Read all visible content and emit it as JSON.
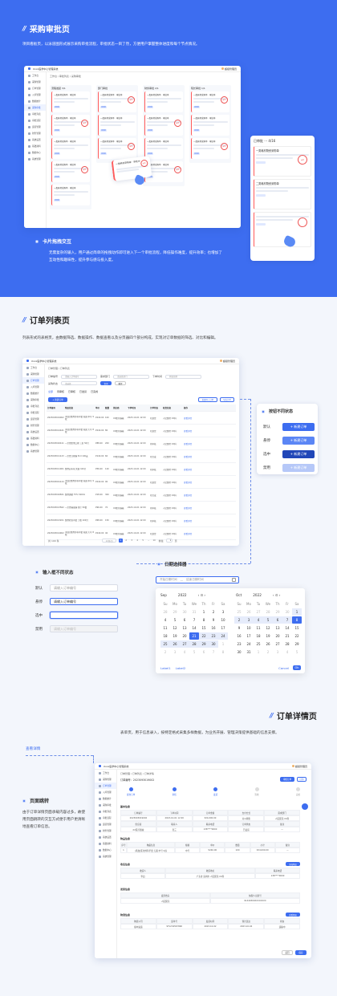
{
  "section1": {
    "title": "采购审批页",
    "desc": "项目看板页，以泳道图形式展示采购审批流程，审批状态一目了然，方便用户掌握整体进度和每个节点情况。",
    "bullet_title": "卡片拖拽交互",
    "bullet_desc": "无需复杂的输入，用户通过简单的拖拽动作即可进入下一个审批流程，降低操作难度，提升效率；也增加了互动性和趣味性，提升参与感与投入度。",
    "app": {
      "logo": "Xxxx医学中心管理系统",
      "breadcrumb": "工作台 / 审批列表 / 采购审批",
      "user": "超级管理员",
      "side_items": [
        "工作台",
        "采购管理",
        "订单管理",
        "入库管理",
        "数据统计",
        "采购审批",
        "审批列表",
        "审批流程",
        "运营管理",
        "财务管理",
        "系统设置",
        "基础资料",
        "数据中心",
        "系统管理"
      ],
      "columns": [
        "流程发起 3/1",
        "部门审批",
        "财务审批 2/1",
        "院长审批 1/1"
      ],
      "card_title": "一类耗材采购单 · 审批中",
      "card_tag": "待审批",
      "stamp": "审批"
    },
    "popup": {
      "title": "已审批 ··· 4/16",
      "card1": "一类耗材物资采购单",
      "card2": "二类耗材物资采购单",
      "stamp": "审批"
    }
  },
  "section2": {
    "title": "订单列表页",
    "desc": "列表形式的表格页，由数据筛选、数据操作、数据查看以及分页器四个部分构成，实现对订单数据的筛选、对比和编辑。",
    "app": {
      "logo": "Xxxx医学中心管理系统",
      "breadcrumb": "订单管理 / 订单列表",
      "user": "超级管理员",
      "filters": {
        "order_no": "订单编号",
        "order_ph": "请输入订单编号",
        "dept": "需求部门",
        "dept_ph": "请选择部门",
        "time": "下单时间",
        "start": "开始日期",
        "end": "结束日期",
        "status": "采购状态",
        "status_ph": "请选择",
        "search": "查询",
        "reset": "重置"
      },
      "tabs": [
        "全部",
        "待审核",
        "已审核",
        "已发货",
        "已完成"
      ],
      "new_btn": "+ 新建订单",
      "bulk": [
        "批量导入订单",
        "导出订单"
      ],
      "columns": [
        "订单编号",
        "物品信息",
        "单价",
        "数量",
        "供应商",
        "下单时间",
        "订单状态",
        "收货信息",
        "操作"
      ],
      "rows": [
        [
          "2023093019002",
          "(乳胶)医用外科手套 无菌 中号 9双",
          "¥240.00",
          "100",
          "XX医疗器械",
          "2023-10-01 12:00",
          "已发货",
          "人民医院 XX科",
          "查看详情"
        ],
        [
          "2023093014441",
          "(乳胶)医用外科手套 无菌 大号 8双",
          "¥240.00",
          "80",
          "XX医疗器械",
          "2023-10-01 12:00",
          "已发货",
          "人民医院 XX科",
          "查看详情"
        ],
        [
          "2023093016411",
          "一次性医用口罩 三层 50只",
          "¥88.00",
          "200",
          "XX医疗器械",
          "2023-10-01 12:00",
          "待审核",
          "人民医院 XX科",
          "查看详情"
        ],
        [
          "2023093011123",
          "一次性注射器 5ml 100支",
          "¥140.00",
          "60",
          "XX医疗器械",
          "2023-10-01 12:00",
          "已完成",
          "人民医院 XX科",
          "查看详情"
        ],
        [
          "2023093011001",
          "医用纱布块 灭菌 100片",
          "¥56.00",
          "120",
          "XX医疗器械",
          "2023-10-01 12:00",
          "已审核",
          "人民医院 XX科",
          "查看详情"
        ],
        [
          "2023093001124",
          "(乳胶)医用外科手套 无菌 中号 9双",
          "¥240.00",
          "90",
          "XX医疗器械",
          "2023-10-01 12:00",
          "已发货",
          "人民医院 XX科",
          "查看详情"
        ],
        [
          "2023093016821",
          "医用酒精 75% 500ml",
          "¥18.00",
          "300",
          "XX医疗器械",
          "2023-10-01 12:00",
          "已完成",
          "人民医院 XX科",
          "查看详情"
        ],
        [
          "2023093013562",
          "一次性输液器 带针 50套",
          "¥96.00",
          "70",
          "XX医疗器械",
          "2023-10-01 12:00",
          "待审核",
          "人民医院 XX科",
          "查看详情"
        ],
        [
          "2023093013201",
          "医用检查手套 丁腈 100只",
          "¥68.00",
          "150",
          "XX医疗器械",
          "2023-10-01 12:00",
          "已审核",
          "人民医院 XX科",
          "查看详情"
        ],
        [
          "2023093014902",
          "(乳胶)医用外科手套 无菌 大号 8双",
          "¥240.00",
          "40",
          "XX医疗器械",
          "2023-10-01 12:00",
          "已发货",
          "人民医院 XX科",
          "查看详情"
        ]
      ],
      "pager": {
        "total": "共 100 条",
        "size": "10条/页",
        "pages": [
          "1",
          "2",
          "3",
          "4",
          "5",
          "...",
          "10"
        ],
        "goto": "前往",
        "page": "1",
        "unit": "页"
      }
    },
    "button_states": {
      "title": "按钮不同状态",
      "labels": [
        "默认",
        "悬停",
        "选中",
        "禁用"
      ],
      "btn": "+ 新建订单"
    },
    "input_states": {
      "title": "输入框不同状态",
      "labels": [
        "默认",
        "悬停",
        "选中",
        "禁用"
      ],
      "values": [
        "请输入订单编号",
        "请输入订单编号",
        "",
        "请输入订单编号"
      ]
    },
    "date_picker": {
      "title": "日期选择器",
      "start_ph": "开始日期时间",
      "sep": "—",
      "end_ph": "结束日期时间",
      "left": {
        "month": "Sep",
        "year": "2022",
        "nav": "‹ ⊙ ›"
      },
      "right": {
        "month": "Oct",
        "year": "2022",
        "nav": "‹ ⊙ ›"
      },
      "weekdays": [
        "Su",
        "Mo",
        "Tu",
        "We",
        "Th",
        "Fr",
        "Sa"
      ],
      "left_days": [
        "28",
        "29",
        "30",
        "31",
        "1",
        "2",
        "3",
        "4",
        "5",
        "6",
        "7",
        "8",
        "9",
        "10",
        "11",
        "12",
        "13",
        "14",
        "15",
        "16",
        "17",
        "18",
        "19",
        "20",
        "21",
        "22",
        "23",
        "24",
        "25",
        "26",
        "27",
        "28",
        "29",
        "30",
        "1",
        "2",
        "3",
        "4",
        "5",
        "6",
        "7",
        "8"
      ],
      "right_days": [
        "25",
        "26",
        "27",
        "28",
        "29",
        "30",
        "1",
        "2",
        "3",
        "4",
        "5",
        "6",
        "7",
        "8",
        "9",
        "10",
        "11",
        "12",
        "13",
        "14",
        "15",
        "16",
        "17",
        "18",
        "19",
        "20",
        "21",
        "22",
        "23",
        "24",
        "25",
        "26",
        "27",
        "28",
        "29",
        "30",
        "31",
        "1",
        "2",
        "3",
        "4",
        "5"
      ],
      "label1": "Label1",
      "label2": "Label2",
      "cancel": "Cancel",
      "ok": "Ok"
    }
  },
  "section3": {
    "title": "订单详情页",
    "desc": "表单页，用于信息录入，按特定格式采集多样数据，为业务开展、管理决策提供基础的信息支撑。",
    "link": "查看详情",
    "bullet_title": "页面跳转",
    "bullet_desc": "由于订单详情页面承载内容过多，故使用页面跳转的交互方式便于用户更清晰地查看订单信息。",
    "app": {
      "logo": "Xxxx医学中心管理系统",
      "breadcrumb": "订单管理 / 订单列表 / 订单详情",
      "user": "超级管理员",
      "order_no": "订单编号：2023093019002",
      "actions": [
        "审核订单",
        "打印"
      ],
      "steps": [
        "提交订单",
        "审核",
        "发货",
        "签收",
        "完成"
      ],
      "basic_title": "基本信息",
      "basic_head": [
        "订单编号",
        "下单时间",
        "订单金额",
        "支付方式",
        "需求部门"
      ],
      "basic_val": [
        "2023093019002",
        "2023-10-01 12:00",
        "¥24,000.00",
        "对公转账",
        "人民医院 XX科"
      ],
      "basic_head2": [
        "供应商",
        "联系人",
        "联系电话",
        "订单状态",
        "备注"
      ],
      "basic_val2": [
        "XX医疗器械",
        "张三",
        "138****0000",
        "已发货",
        "—"
      ],
      "goods_title": "物品信息",
      "goods_head": [
        "序号",
        "物品信息",
        "规格",
        "单价",
        "数量",
        "小计",
        "备注"
      ],
      "goods_row": [
        "1",
        "(乳胶)医用外科手套 无菌 中号 9双",
        "中号",
        "¥240.00",
        "100",
        "¥24,000.00",
        "—"
      ],
      "goods_btn": "添加物品",
      "receive_title": "收货信息",
      "receive_head": [
        "收货人",
        "收货地址",
        "联系电话"
      ],
      "receive_row": [
        "李四",
        "广东省 深圳市 人民医院 XX科",
        "138****0000"
      ],
      "invoice_title": "发票信息",
      "invoice_head": [
        "发票抬头",
        "纳税人识别号"
      ],
      "invoice_row": [
        "人民医院",
        "91440300XXXXXXXX"
      ],
      "logi_title": "物流信息",
      "logi_head": [
        "物流公司",
        "运单号",
        "发货时间",
        "预计送达",
        "状态"
      ],
      "logi_row": [
        "顺丰速运",
        "SF1234567890",
        "2023-10-02",
        "2023-10-04",
        "运输中"
      ],
      "logi_btn": "查看物流",
      "footer": [
        "返回",
        "保存"
      ]
    }
  }
}
